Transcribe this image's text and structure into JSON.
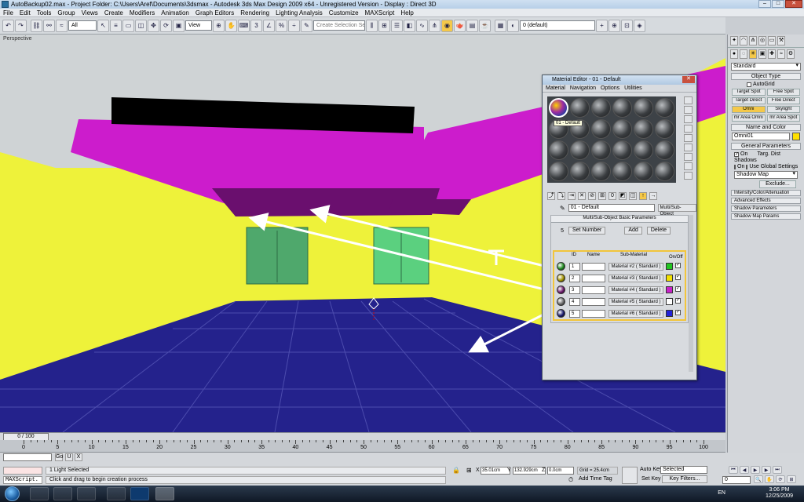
{
  "window": {
    "title": "AutoBackup02.max - Project Folder: C:\\Users\\Aref\\Documents\\3dsmax - Autodesk 3ds Max Design 2009 x64 - Unregistered Version - Display : Direct 3D"
  },
  "menu": [
    "File",
    "Edit",
    "Tools",
    "Group",
    "Views",
    "Create",
    "Modifiers",
    "Animation",
    "Graph Editors",
    "Rendering",
    "Lighting Analysis",
    "Customize",
    "MAXScript",
    "Help"
  ],
  "toolbar": {
    "filter": "All",
    "refcoord": "View",
    "selset": "Create Selection Set",
    "layer": "0 (default)"
  },
  "viewport": {
    "label": "Perspective"
  },
  "colors": {
    "yellow": "#eef23a",
    "blue": "#24228c",
    "magenta": "#cc1ccc",
    "darkpurple": "#6a0f6e",
    "green": "#4fa86c"
  },
  "material_editor": {
    "title": "Material Editor - 01 - Default",
    "menu": [
      "Material",
      "Navigation",
      "Options",
      "Utilities"
    ],
    "tooltip": "01 - Default",
    "material_name": "01 - Default",
    "material_type": "Multi/Sub-Object",
    "rollout": "Multi/Sub-Object Basic Parameters",
    "count": "5",
    "set_number": "Set Number",
    "add": "Add",
    "delete": "Delete",
    "columns": {
      "id": "ID",
      "name": "Name",
      "sub": "Sub-Material",
      "onoff": "On/Off"
    },
    "rows": [
      {
        "id": "1",
        "sub": "Material #2  ( Standard )",
        "color": "#22c522",
        "ball": "#1f8a1f"
      },
      {
        "id": "2",
        "sub": "Material #3  ( Standard )",
        "color": "#f2e000",
        "ball": "#a09000"
      },
      {
        "id": "3",
        "sub": "Material #4  ( Standard )",
        "color": "#c822c8",
        "ball": "#6a166a"
      },
      {
        "id": "4",
        "sub": "Material #5  ( Standard )",
        "color": "#ffffff",
        "ball": "#6a6a6a"
      },
      {
        "id": "5",
        "sub": "Material #6  ( Standard )",
        "color": "#2222d8",
        "ball": "#16166a"
      }
    ]
  },
  "command_panel": {
    "dropdown": "Standard",
    "object_type": "Object Type",
    "autogrid": "AutoGrid",
    "buttons": [
      "Target Spot",
      "Free Spot",
      "Target Direct",
      "Free Direct",
      "Omni",
      "Skylight",
      "mr Area Omni",
      "mr Area Spot"
    ],
    "name_and_color": "Name and Color",
    "name": "Omni01",
    "general": "General Parameters",
    "on": "On",
    "targ_dist": "Targ. Dist",
    "shadows": "Shadows",
    "shadows_on": "On",
    "use_global": "Use Global Settings",
    "shadow_map": "Shadow Map",
    "exclude": "Exclude...",
    "collapsed": [
      "Intensity/Color/Attenuation",
      "Advanced Effects",
      "Shadow Parameters",
      "Shadow Map Params"
    ]
  },
  "timeline": {
    "frame": "0 / 100",
    "ticks": [
      "0",
      "5",
      "10",
      "15",
      "20",
      "25",
      "30",
      "35",
      "40",
      "45",
      "50",
      "55",
      "60",
      "65",
      "70",
      "75",
      "80",
      "85",
      "90",
      "95",
      "100"
    ]
  },
  "status": {
    "maxscript": "MAXScript.",
    "selected": "1 Light Selected",
    "prompt": "Click and drag to begin creation process",
    "x_label": "X",
    "x": "35.01cm",
    "y_label": "Y",
    "y": "132.929cm",
    "z_label": "Z",
    "z": "0.0cm",
    "grid": "Grid = 25.4cm",
    "add_time_tag": "Add Time Tag",
    "auto_key": "Auto Key",
    "key_sel": "Selected",
    "set_key": "Set Key",
    "key_filters": "Key Filters...",
    "frame": "0",
    "go": "Go"
  },
  "taskbar": {
    "lang": "EN",
    "time": "3:06 PM",
    "date": "12/25/2009"
  }
}
